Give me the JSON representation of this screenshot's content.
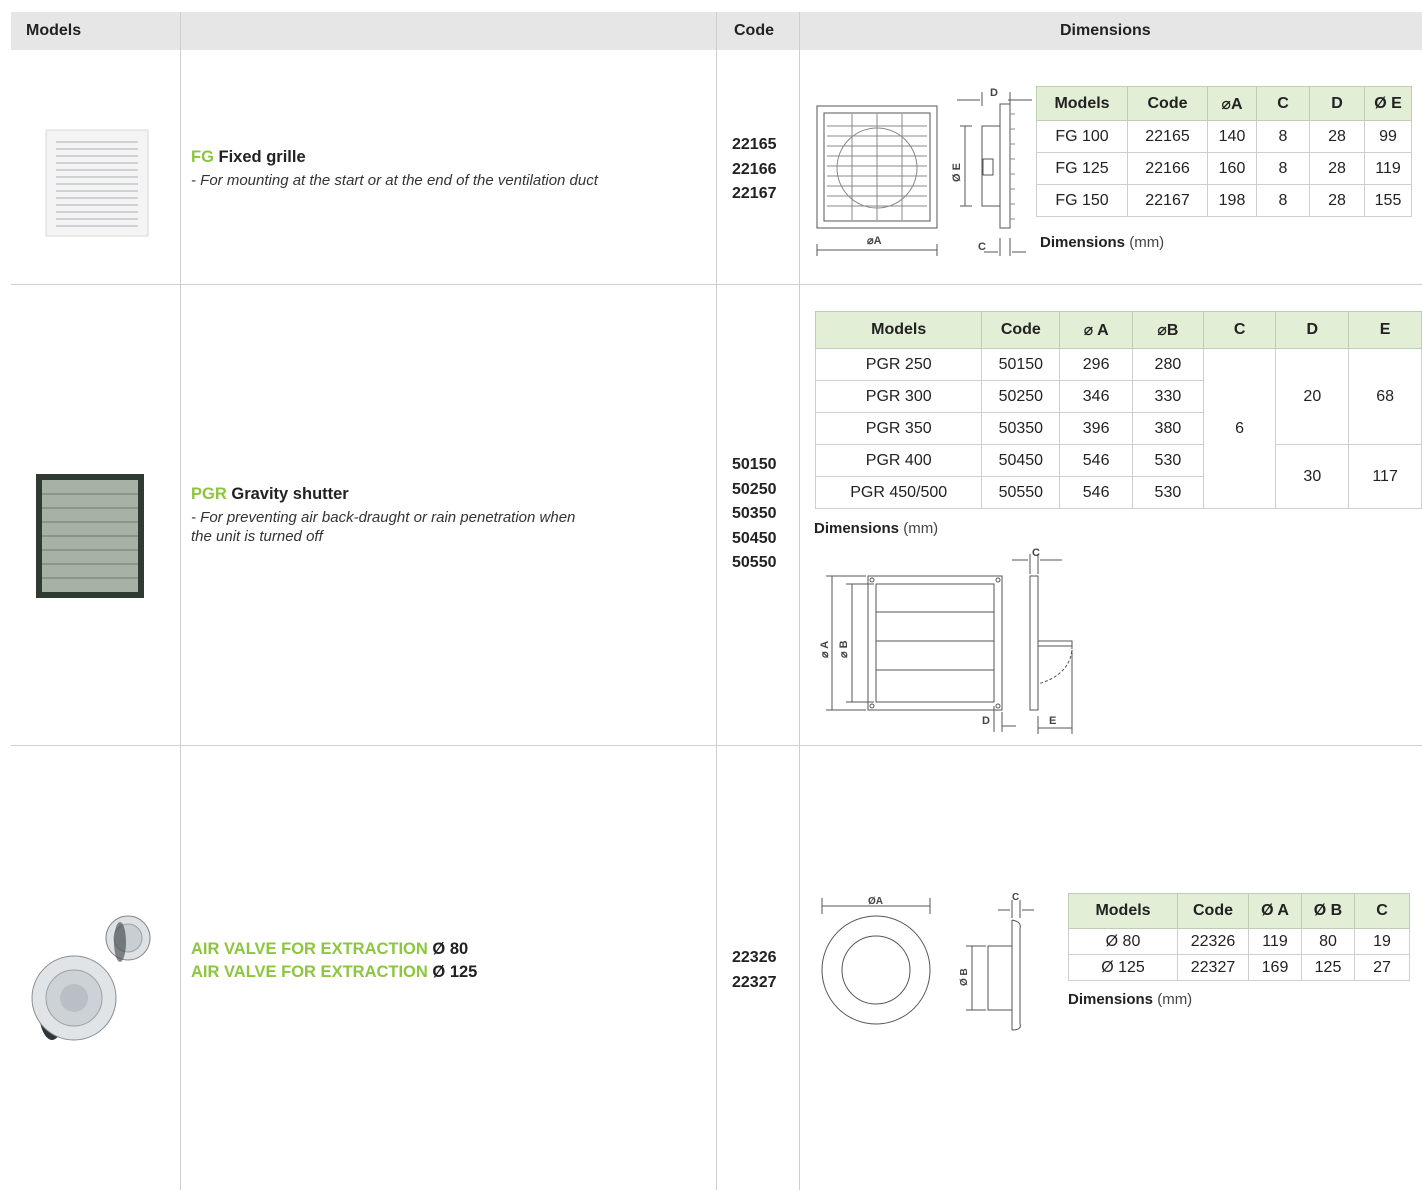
{
  "header": {
    "models": "Models",
    "code": "Code",
    "dimensions": "Dimensions"
  },
  "products": [
    {
      "prefix": "FG",
      "name": "Fixed grille",
      "description": "- For mounting at the start or at the end of the ventilation duct",
      "codes": [
        "22165",
        "22166",
        "22167"
      ],
      "table": {
        "headers": [
          "Models",
          "Code",
          "⌀A",
          "C",
          "D",
          "Ø E"
        ],
        "rows": [
          [
            "FG 100",
            "22165",
            "140",
            "8",
            "28",
            "99"
          ],
          [
            "FG 125",
            "22166",
            "160",
            "8",
            "28",
            "119"
          ],
          [
            "FG 150",
            "22167",
            "198",
            "8",
            "28",
            "155"
          ]
        ]
      },
      "dim_label_bold": "Dimensions",
      "dim_label_unit": " (mm)",
      "drawing_labels": {
        "a": "⌀A",
        "c": "C",
        "d": "D",
        "e": "Ø E"
      }
    },
    {
      "prefix": "PGR",
      "name": "Gravity shutter",
      "description_line1": "- For preventing air back-draught or rain penetration when",
      "description_line2": "the unit is turned off",
      "codes": [
        "50150",
        "50250",
        "50350",
        "50450",
        "50550"
      ],
      "table": {
        "headers": [
          "Models",
          "Code",
          "⌀ A",
          "⌀B",
          "C",
          "D",
          "E"
        ],
        "rows": [
          [
            "PGR 250",
            "50150",
            "296",
            "280"
          ],
          [
            "PGR 300",
            "50250",
            "346",
            "330"
          ],
          [
            "PGR 350",
            "50350",
            "396",
            "380"
          ],
          [
            "PGR 400",
            "50450",
            "546",
            "530"
          ],
          [
            "PGR 450/500",
            "50550",
            "546",
            "530"
          ]
        ],
        "c_value": "6",
        "d_small": "20",
        "e_small": "68",
        "d_large": "30",
        "e_large": "117"
      },
      "dim_label_bold": "Dimensions",
      "dim_label_unit": " (mm)",
      "drawing_labels": {
        "a": "⌀ A",
        "b": "⌀ B",
        "c": "C",
        "d": "D",
        "e": "E"
      }
    },
    {
      "line1_green": "AIR VALVE FOR EXTRACTION",
      "line1_dim": " Ø 80",
      "line2_green": "AIR VALVE FOR EXTRACTION",
      "line2_dim": " Ø 125",
      "codes": [
        "22326",
        "22327"
      ],
      "table": {
        "headers": [
          "Models",
          "Code",
          "Ø A",
          "Ø B",
          "C"
        ],
        "rows": [
          [
            "Ø 80",
            "22326",
            "119",
            "80",
            "19"
          ],
          [
            "Ø 125",
            "22327",
            "169",
            "125",
            "27"
          ]
        ]
      },
      "dim_label_bold": "Dimensions",
      "dim_label_unit": " (mm)",
      "drawing_labels": {
        "a": "ØA",
        "b": "Ø B",
        "c": "C"
      }
    }
  ],
  "colors": {
    "accent_green": "#8cc63f",
    "table_header_bg": "#e2efd6",
    "header_bg": "#e6e6e6"
  }
}
